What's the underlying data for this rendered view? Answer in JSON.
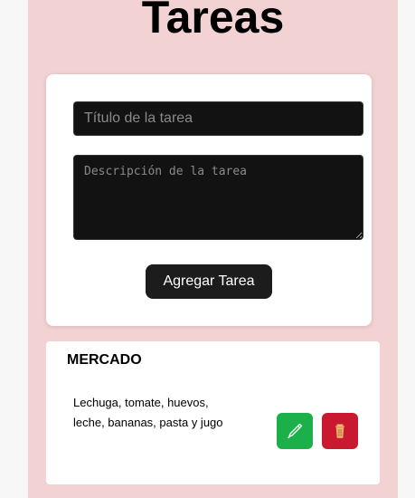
{
  "header": {
    "title": "Tareas"
  },
  "form": {
    "title_placeholder": "Título de la tarea",
    "title_value": "",
    "description_placeholder": "Descripción de la tarea",
    "description_value": "",
    "add_label": "Agregar Tarea"
  },
  "tasks": [
    {
      "title": "MERCADO",
      "description": "Lechuga, tomate, huevos, leche, bananas, pasta y jugo",
      "edit_icon": "pencil-icon",
      "delete_icon": "trash-icon"
    }
  ],
  "colors": {
    "column_bg": "#f2d2d3",
    "edit_button": "#1bb04a",
    "delete_button": "#c8192f",
    "primary_button": "#1c1c1c",
    "input_bg": "#121212"
  }
}
